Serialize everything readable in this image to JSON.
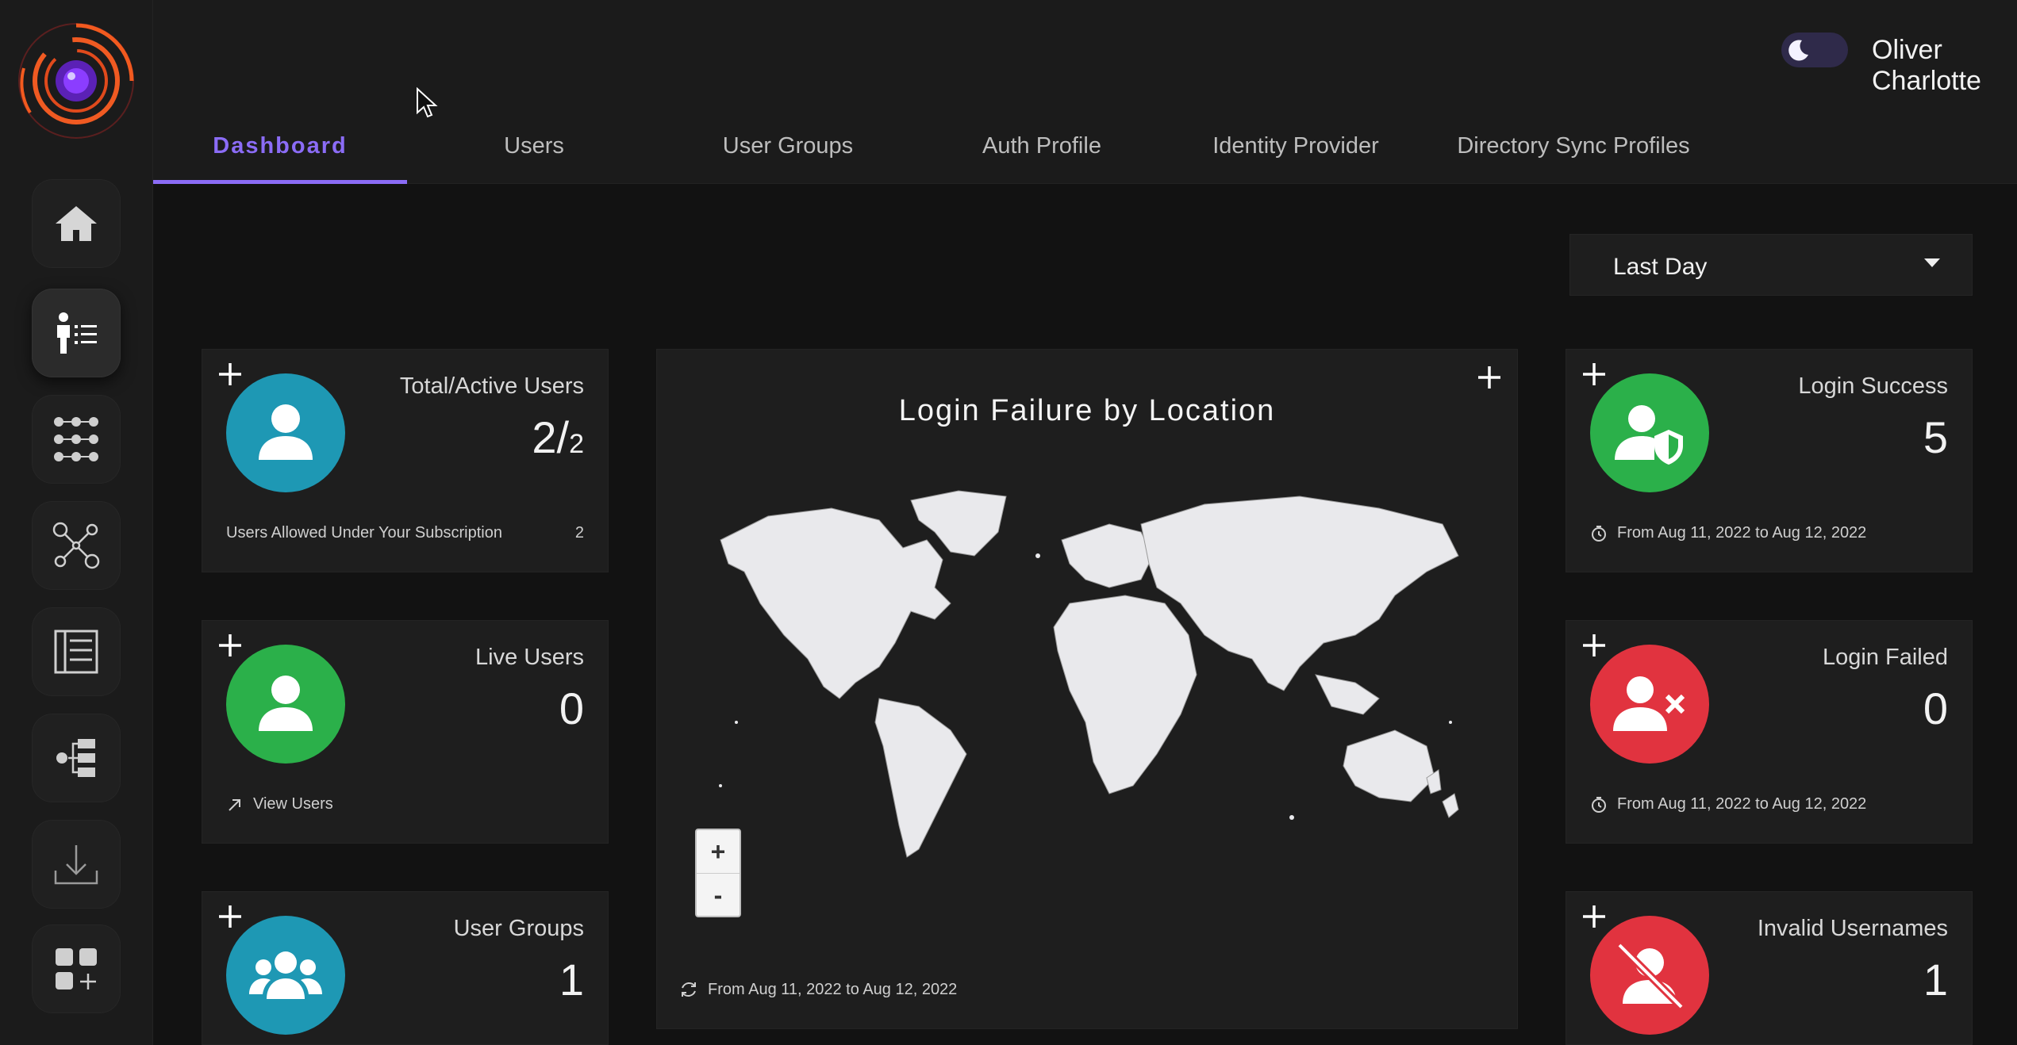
{
  "header": {
    "user_name": "Oliver Charlotte",
    "theme_toggle": "dark"
  },
  "tabs": [
    {
      "label": "Dashboard",
      "active": true
    },
    {
      "label": "Users",
      "active": false
    },
    {
      "label": "User Groups",
      "active": false
    },
    {
      "label": "Auth Profile",
      "active": false
    },
    {
      "label": "Identity Provider",
      "active": false
    },
    {
      "label": "Directory Sync Profiles",
      "active": false
    }
  ],
  "sidebar": {
    "icons": [
      "home-icon",
      "user-directory-icon",
      "apps-grid-icon",
      "user-network-icon",
      "list-panel-icon",
      "settings-tree-icon",
      "download-icon",
      "add-widget-icon"
    ],
    "active_index": 1
  },
  "filter": {
    "selected": "Last Day"
  },
  "cards": {
    "total_users": {
      "title": "Total/Active Users",
      "value_main": "2/",
      "value_sub": "2",
      "footer_label": "Users Allowed Under Your Subscription",
      "footer_value": "2",
      "color": "#1e98b4"
    },
    "live_users": {
      "title": "Live Users",
      "value": "0",
      "footer_label": "View Users",
      "color": "#2bb04a"
    },
    "user_groups": {
      "title": "User Groups",
      "value": "1",
      "color": "#1e98b4"
    },
    "login_success": {
      "title": "Login Success",
      "value": "5",
      "footer_label": "From Aug 11, 2022 to Aug 12, 2022",
      "color": "#2bb04a"
    },
    "login_failed": {
      "title": "Login Failed",
      "value": "0",
      "footer_label": "From Aug 11, 2022 to Aug 12, 2022",
      "color": "#e1333f"
    },
    "invalid_usernames": {
      "title": "Invalid Usernames",
      "value": "1",
      "color": "#e1333f"
    }
  },
  "map": {
    "title": "Login Failure by Location",
    "zoom_in": "+",
    "zoom_out": "-",
    "footer_label": "From Aug 11, 2022 to Aug 12, 2022"
  },
  "colors": {
    "accent": "#8b6cf6",
    "background": "#121212",
    "panel": "#1e1e1e"
  }
}
